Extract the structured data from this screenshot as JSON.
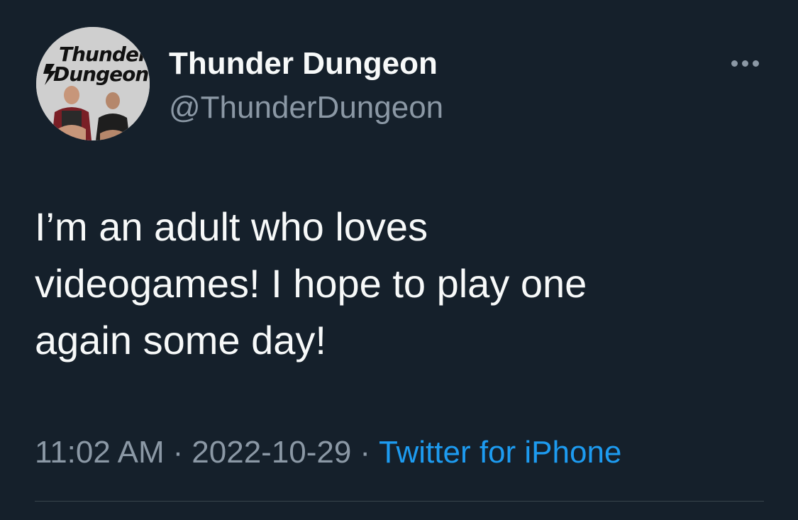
{
  "tweet": {
    "author": {
      "display_name": "Thunder Dungeon",
      "handle": "@ThunderDungeon",
      "avatar_logo_text": "Thunder Dungeon"
    },
    "more_icon": "more-horizontal-icon",
    "text": "I’m an adult who loves\nvideogames! I hope to play one\nagain some day!",
    "meta": {
      "time": "11:02 AM",
      "separator": "·",
      "date": "2022-10-29",
      "source": "Twitter for iPhone"
    }
  },
  "colors": {
    "background": "#15202b",
    "primary_text": "#f7f9f9",
    "secondary_text": "#8b98a5",
    "link": "#1d9bf0",
    "divider": "#38444d"
  }
}
